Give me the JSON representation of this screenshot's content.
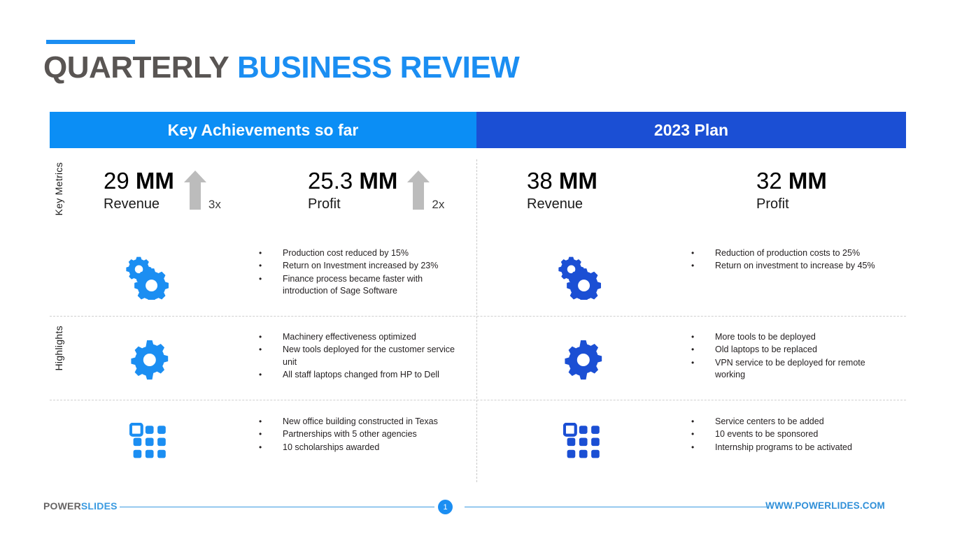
{
  "slide": {
    "title_part1": "QUARTERLY",
    "title_part2": "BUSINESS REVIEW"
  },
  "colors": {
    "accent_bright_blue": "#1b8ef2",
    "accent_dark_blue": "#1b4fd4",
    "title_dark": "#595553",
    "arrow_gray": "#bcbcbc"
  },
  "columns": {
    "left": {
      "header": "Key Achievements so far"
    },
    "right": {
      "header": "2023 Plan"
    }
  },
  "row_labels": {
    "metrics": "Key Metrics",
    "highlights": "Highlights"
  },
  "metrics": [
    {
      "number": "29",
      "unit": "MM",
      "label": "Revenue",
      "multiplier": "3x",
      "has_arrow": true
    },
    {
      "number": "25.3",
      "unit": "MM",
      "label": "Profit",
      "multiplier": "2x",
      "has_arrow": true
    },
    {
      "number": "38",
      "unit": "MM",
      "label": "Revenue",
      "multiplier": "",
      "has_arrow": false
    },
    {
      "number": "32",
      "unit": "MM",
      "label": "Profit",
      "multiplier": "",
      "has_arrow": false
    }
  ],
  "rows": [
    {
      "icon": "two-gears-icon",
      "left_bullets": [
        "Production cost reduced by 15%",
        "Return on Investment increased by 23%",
        "Finance process became faster with introduction of Sage Software"
      ],
      "right_bullets": [
        "Reduction of production costs to 25%",
        "Return on investment to increase by 45%"
      ]
    },
    {
      "icon": "gear-icon",
      "left_bullets": [
        "Machinery effectiveness optimized",
        "New tools deployed for the customer service unit",
        "All staff laptops changed from HP to Dell"
      ],
      "right_bullets": [
        "More tools to be deployed",
        "Old laptops to be replaced",
        "VPN service to be deployed for remote working"
      ]
    },
    {
      "icon": "grid-icon",
      "left_bullets": [
        "New office building constructed in Texas",
        "Partnerships with 5 other agencies",
        "10 scholarships awarded"
      ],
      "right_bullets": [
        "Service centers to be added",
        "10 events to be sponsored",
        "Internship programs to be activated"
      ]
    }
  ],
  "bullet_marker": "•",
  "footer": {
    "logo_part1": "POWER",
    "logo_part2": "SLIDES",
    "page_number": "1",
    "url": "WWW.POWERLIDES.COM"
  }
}
